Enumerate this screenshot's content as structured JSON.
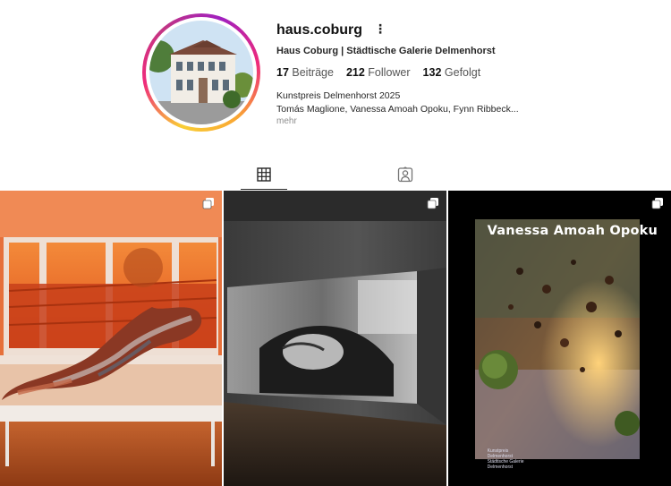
{
  "profile": {
    "username": "haus.coburg",
    "full_name": "Haus Coburg | Städtische Galerie Delmenhorst",
    "stats": [
      {
        "count": "17",
        "label": "Beiträge"
      },
      {
        "count": "212",
        "label": "Follower"
      },
      {
        "count": "132",
        "label": "Gefolgt"
      }
    ],
    "bio_line1": "Kunstpreis Delmenhorst 2025",
    "bio_line2": "Tomás Maglione, Vanessa Amoah Opoku, Fynn Ribbeck...",
    "more_label": "mehr"
  },
  "tabs": [
    {
      "icon": "grid-icon",
      "active": true
    },
    {
      "icon": "tagged-user-icon",
      "active": false
    }
  ],
  "posts": [
    {
      "icon": "carousel-icon"
    },
    {
      "icon": "carousel-icon"
    },
    {
      "icon": "carousel-icon",
      "cover_title": "Vanessa Amoah Opoku",
      "cover_foot": "Kunstpreis Delmenhorst Städtische Galerie Delmenhorst"
    }
  ],
  "colors": {
    "text": "#262626",
    "muted": "#8e8e8e",
    "ring_start": "#f9ce34",
    "ring_end": "#c13584"
  }
}
